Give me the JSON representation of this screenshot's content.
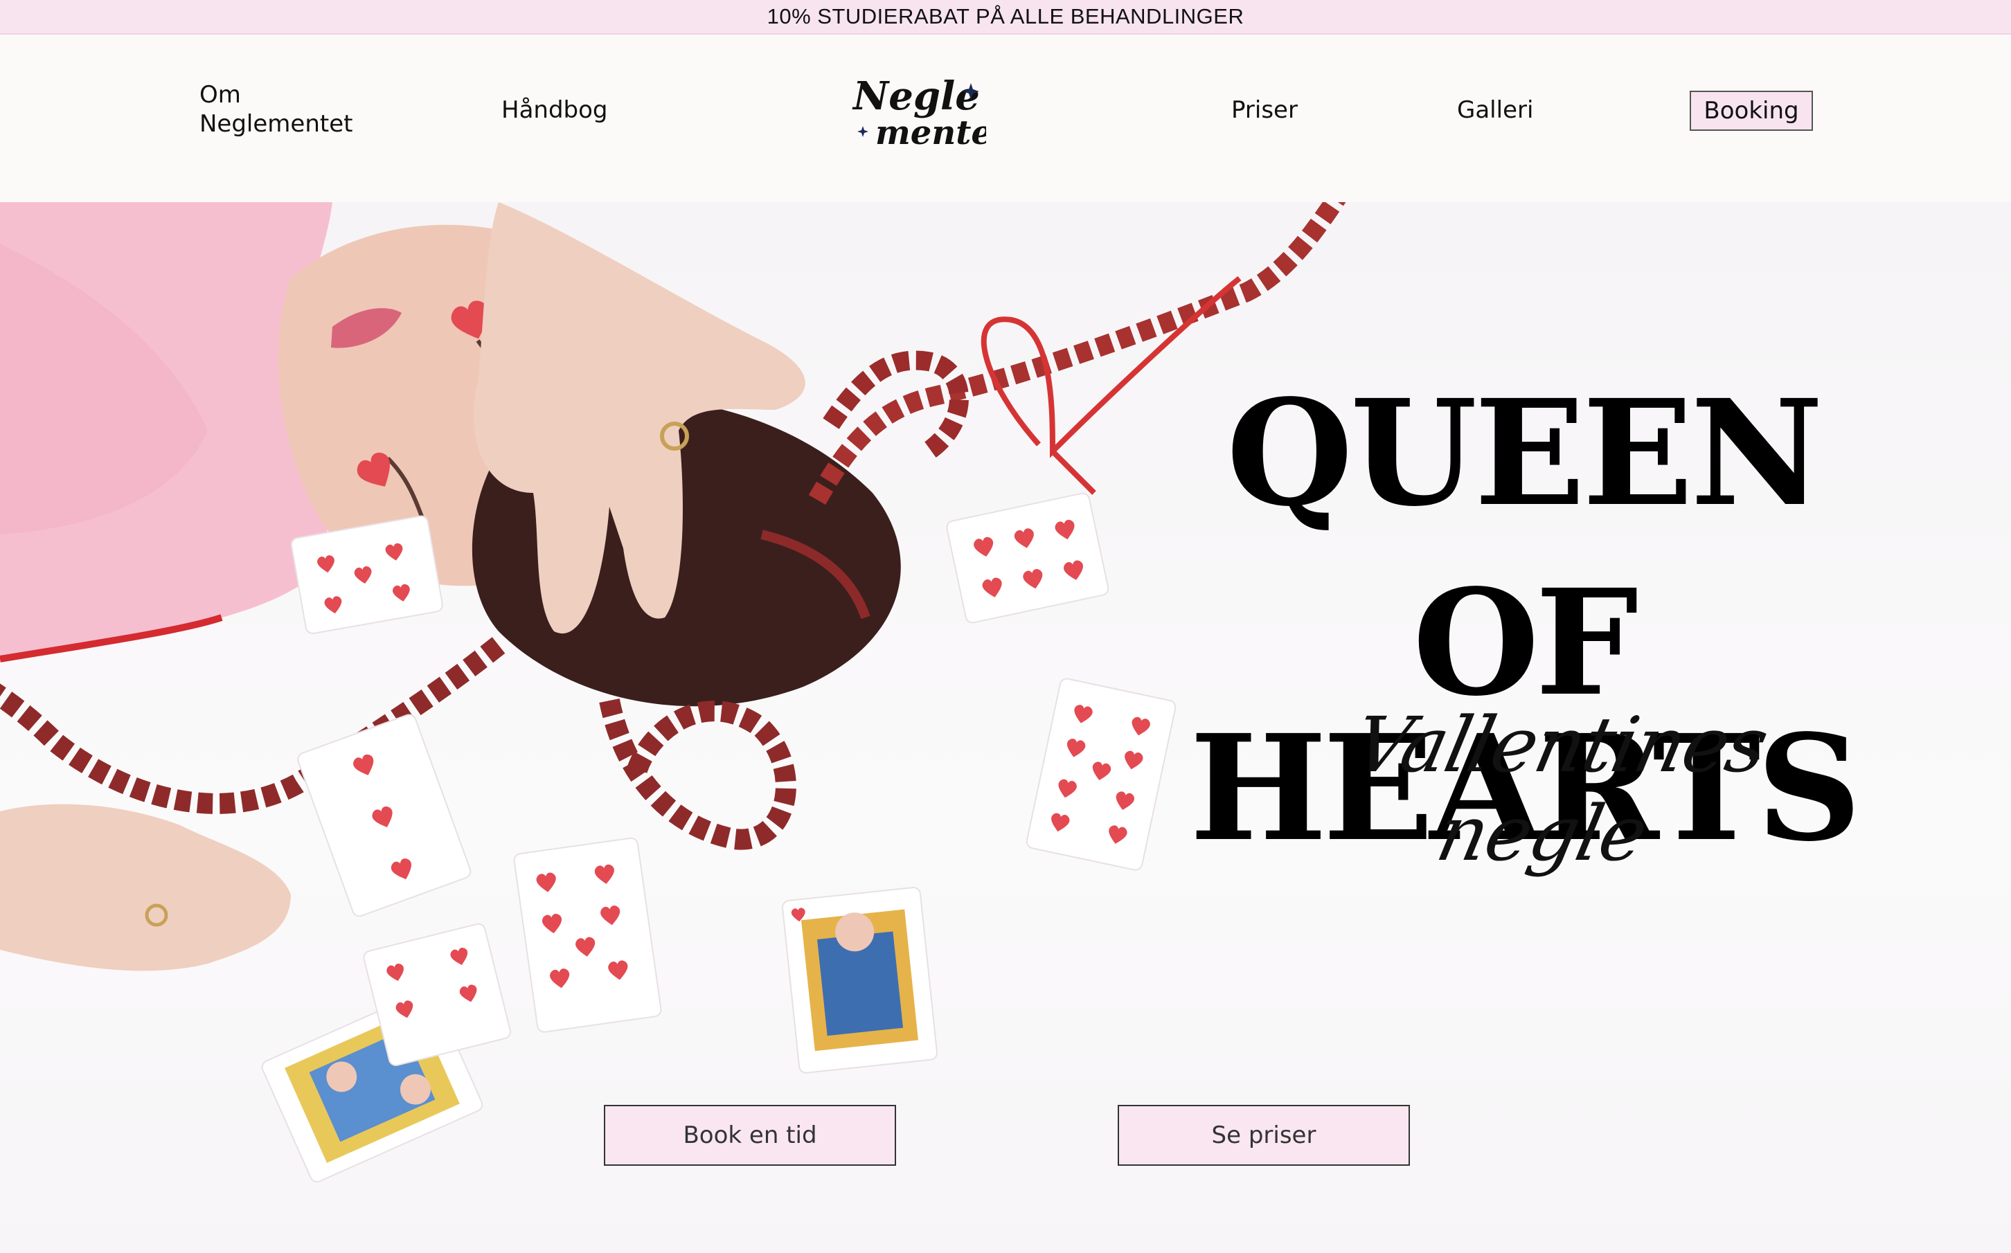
{
  "promo": {
    "text": "10% STUDIERABAT PÅ ALLE BEHANDLINGER"
  },
  "nav": {
    "om_line1": "Om",
    "om_line2": "Neglementet",
    "handbog": "Håndbog",
    "priser": "Priser",
    "galleri": "Galleri",
    "booking": "Booking"
  },
  "logo": {
    "line1": "Negle",
    "line2": "mentet"
  },
  "hero": {
    "title_line1": "QUEEN",
    "title_line2": "OF HEARTS",
    "subtitle": "Vallentines negle",
    "book_button": "Book en tid",
    "prices_button": "Se priser"
  },
  "colors": {
    "promo_bg": "#f7e4ef",
    "button_bg": "#f9e6f0",
    "accent_red": "#d8323a",
    "hair": "#3b1f1d"
  }
}
